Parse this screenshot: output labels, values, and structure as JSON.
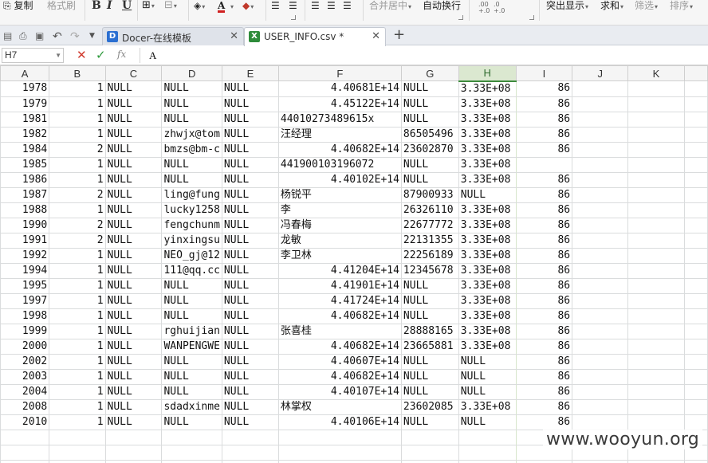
{
  "ribbon": {
    "copy": "复制",
    "format_painter": "格式刷",
    "merge_center": "合并居中",
    "wrap_text": "自动换行",
    "highlight": "突出显示",
    "sum": "求和",
    "filter": "筛选",
    "sort": "排序"
  },
  "tabs": [
    {
      "label": "Docer-在线模板",
      "icon": "docer-icon"
    },
    {
      "label": "USER_INFO.csv *",
      "icon": "spreadsheet-icon"
    }
  ],
  "formula_bar": {
    "cell_ref": "H7",
    "value": "A"
  },
  "sheet": {
    "columns": [
      "A",
      "B",
      "C",
      "D",
      "E",
      "F",
      "G",
      "H",
      "I",
      "J",
      "K"
    ],
    "selected_column": "H",
    "rows": [
      [
        "1978",
        "1",
        "NULL",
        "NULL",
        "NULL",
        "4.40681E+14",
        "NULL",
        "3.33E+08",
        "86"
      ],
      [
        "1979",
        "1",
        "NULL",
        "NULL",
        "NULL",
        "4.45122E+14",
        "NULL",
        "3.33E+08",
        "86"
      ],
      [
        "1981",
        "1",
        "NULL",
        "NULL",
        "NULL",
        "44010273489615x",
        "NULL",
        "3.33E+08",
        "86"
      ],
      [
        "1982",
        "1",
        "NULL",
        "zhwjx@tom",
        "NULL",
        "汪经理",
        "86505496",
        "3.33E+08",
        "86"
      ],
      [
        "1984",
        "2",
        "NULL",
        "bmzs@bm-c",
        "NULL",
        "4.40682E+14",
        "23602870",
        "3.33E+08",
        "86"
      ],
      [
        "1985",
        "1",
        "NULL",
        "NULL",
        "NULL",
        "441900103196072",
        "NULL",
        "3.33E+08",
        ""
      ],
      [
        "1986",
        "1",
        "NULL",
        "NULL",
        "NULL",
        "4.40102E+14",
        "NULL",
        "3.33E+08",
        "86"
      ],
      [
        "1987",
        "2",
        "NULL",
        "ling@fung",
        "NULL",
        "杨锐平",
        "87900933",
        "NULL",
        "86"
      ],
      [
        "1988",
        "1",
        "NULL",
        "lucky1258",
        "NULL",
        "李",
        "26326110",
        "3.33E+08",
        "86"
      ],
      [
        "1990",
        "2",
        "NULL",
        "fengchunm",
        "NULL",
        "冯春梅",
        "22677772",
        "3.33E+08",
        "86"
      ],
      [
        "1991",
        "2",
        "NULL",
        "yinxingsu",
        "NULL",
        "龙敏",
        "22131355",
        "3.33E+08",
        "86"
      ],
      [
        "1992",
        "1",
        "NULL",
        "NEO_gj@12",
        "NULL",
        "李卫林",
        "22256189",
        "3.33E+08",
        "86"
      ],
      [
        "1994",
        "1",
        "NULL",
        "111@qq.cc",
        "NULL",
        "4.41204E+14",
        "12345678",
        "3.33E+08",
        "86"
      ],
      [
        "1995",
        "1",
        "NULL",
        "NULL",
        "NULL",
        "4.41901E+14",
        "NULL",
        "3.33E+08",
        "86"
      ],
      [
        "1997",
        "1",
        "NULL",
        "NULL",
        "NULL",
        "4.41724E+14",
        "NULL",
        "3.33E+08",
        "86"
      ],
      [
        "1998",
        "1",
        "NULL",
        "NULL",
        "NULL",
        "4.40682E+14",
        "NULL",
        "3.33E+08",
        "86"
      ],
      [
        "1999",
        "1",
        "NULL",
        "rghuijian",
        "NULL",
        "张喜桂",
        "28888165",
        "3.33E+08",
        "86"
      ],
      [
        "2000",
        "1",
        "NULL",
        "WANPENGWE",
        "NULL",
        "4.40682E+14",
        "23665881",
        "3.33E+08",
        "86"
      ],
      [
        "2002",
        "1",
        "NULL",
        "NULL",
        "NULL",
        "4.40607E+14",
        "NULL",
        "NULL",
        "86"
      ],
      [
        "2003",
        "1",
        "NULL",
        "NULL",
        "NULL",
        "4.40682E+14",
        "NULL",
        "NULL",
        "86"
      ],
      [
        "2004",
        "1",
        "NULL",
        "NULL",
        "NULL",
        "4.40107E+14",
        "NULL",
        "NULL",
        "86"
      ],
      [
        "2008",
        "1",
        "NULL",
        "sdadxinme",
        "NULL",
        "林掌权",
        "23602085",
        "3.33E+08",
        "86"
      ],
      [
        "2010",
        "1",
        "NULL",
        "NULL",
        "NULL",
        "4.40106E+14",
        "NULL",
        "NULL",
        "86"
      ]
    ]
  },
  "watermark": "www.wooyun.org",
  "colors": {
    "selected_header_bg": "#dbe8d0",
    "selected_header_text": "#2f6b2f",
    "gridline": "#dadcdd",
    "cancel_red": "#d03a2e",
    "confirm_green": "#2e9a3c"
  }
}
